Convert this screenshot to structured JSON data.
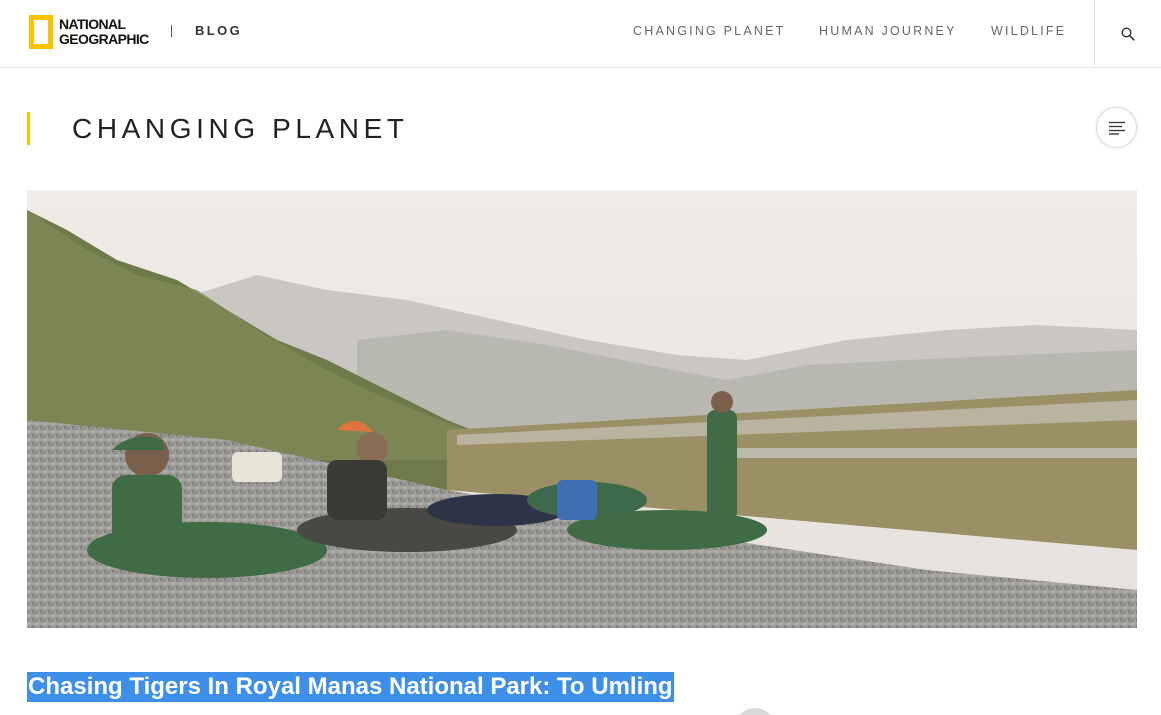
{
  "header": {
    "logo": {
      "line1": "NATIONAL",
      "line2": "GEOGRAPHIC",
      "accent_color": "#f6c400"
    },
    "blog_label": "BLOG",
    "nav": [
      {
        "label": "CHANGING PLANET"
      },
      {
        "label": "HUMAN JOURNEY"
      },
      {
        "label": "WILDLIFE"
      }
    ],
    "search_icon": "search-icon"
  },
  "section": {
    "title": "CHANGING PLANET",
    "menu_icon": "menu-lines-icon"
  },
  "hero": {
    "description_icon": "photo"
  },
  "article": {
    "headline": "Chasing Tigers In Royal Manas National Park: To Umling",
    "selection_color": "#3d8fe8"
  }
}
